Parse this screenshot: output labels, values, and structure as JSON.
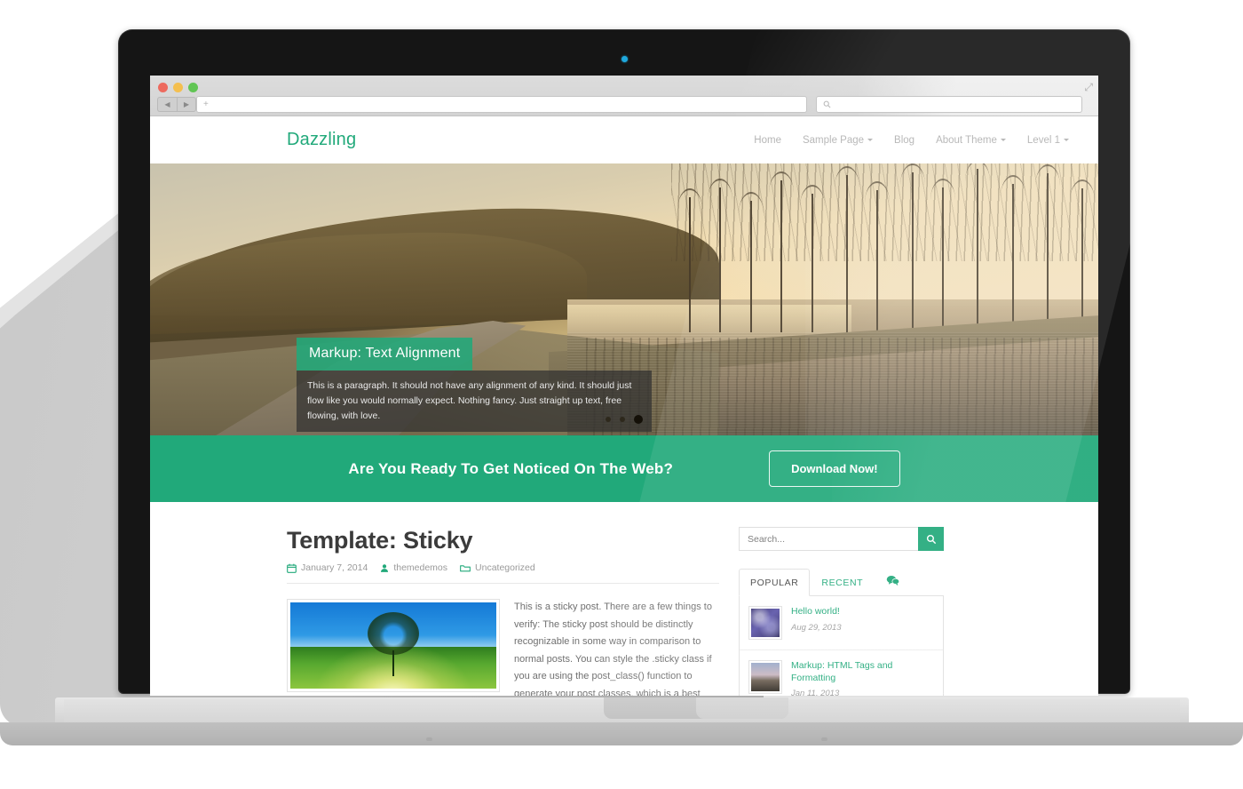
{
  "device": {
    "kind": "laptop-mockup",
    "webcam": "webcam-dot"
  },
  "browser": {
    "traffic_lights": [
      "close",
      "minimize",
      "zoom"
    ],
    "back_icon": "◀",
    "forward_icon": "▶",
    "url_value": "",
    "url_placeholder": "+",
    "search_value": "",
    "search_icon": "search-icon",
    "resize_icon": "⤢"
  },
  "site": {
    "brand": "Dazzling",
    "nav": [
      {
        "label": "Home",
        "has_dropdown": false
      },
      {
        "label": "Sample Page",
        "has_dropdown": true
      },
      {
        "label": "Blog",
        "has_dropdown": false
      },
      {
        "label": "About Theme",
        "has_dropdown": true
      },
      {
        "label": "Level 1",
        "has_dropdown": true
      }
    ]
  },
  "slider": {
    "caption_title": "Markup: Text Alignment",
    "caption_body": "This is a paragraph. It should not have any alignment of any kind. It should just flow like you would normally expect. Nothing fancy. Just straight up text, free flowing, with love.",
    "dots": 3,
    "active_dot": 3
  },
  "cta": {
    "headline": "Are You Ready To Get Noticed On The Web?",
    "button": "Download Now!",
    "background": "#21a97a"
  },
  "post": {
    "title": "Template: Sticky",
    "meta": {
      "date_icon": "calendar-icon",
      "date": "January 7, 2014",
      "author_icon": "user-icon",
      "author": "themedemos",
      "category_icon": "folder-icon",
      "category": "Uncategorized"
    },
    "thumbnail": "tree-sunrise-thumbnail",
    "excerpt": "This is a sticky post. There are a few things to verify: The sticky post should be distinctly recognizable in some way in comparison to normal posts. You can style the .sticky class if you are using the post_class() function to generate your post classes, which is a best practice. They should show at the very top [...]"
  },
  "sidebar": {
    "search_placeholder": "Search...",
    "search_value": "",
    "search_button_icon": "search-icon",
    "tabs": [
      {
        "label": "POPULAR",
        "active": true
      },
      {
        "label": "RECENT",
        "active": false
      },
      {
        "label": "comments-icon",
        "active": false,
        "is_icon": true
      }
    ],
    "items": [
      {
        "title": "Hello world!",
        "date": "Aug 29, 2013",
        "thumb": "abstract-purple-thumbnail"
      },
      {
        "title": "Markup: HTML Tags and Formatting",
        "date": "Jan 11, 2013",
        "thumb": "biplane-sunset-thumbnail"
      }
    ]
  },
  "colors": {
    "accent": "#21a97a",
    "text": "#707070",
    "heading": "#3b3b3b",
    "muted": "#9a9a9a"
  }
}
